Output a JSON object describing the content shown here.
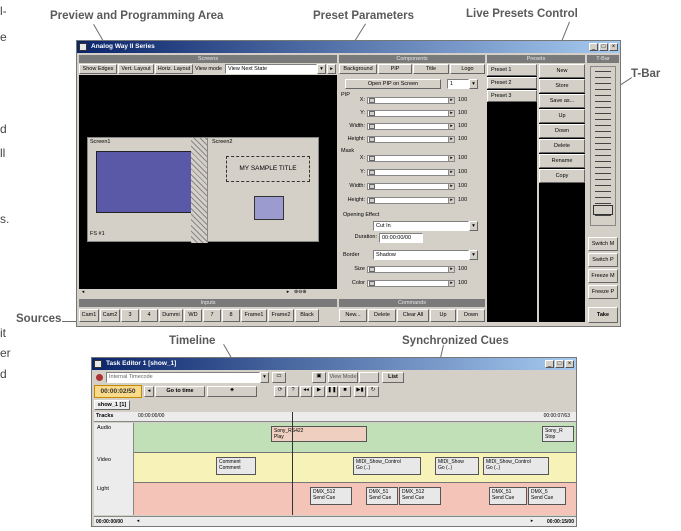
{
  "side_text": {
    "t1": "l-",
    "t2": "e",
    "t3": "d",
    "t4": "ll",
    "t5": "s.",
    "t6": "it",
    "t7": "er",
    "t8": "d"
  },
  "callouts": {
    "preview": "Preview and Programming Area",
    "preset_params": "Preset Parameters",
    "live_presets": "Live Presets Control",
    "tbar": "T-Bar",
    "sources": "Sources",
    "timeline": "Timeline",
    "sync_cues": "Synchronized Cues"
  },
  "main_window": {
    "title": "Analog Way II Series",
    "window_buttons": [
      "_",
      "□",
      "×"
    ],
    "screens_pane": {
      "header": "Screens",
      "toolbar": [
        "Show Edges",
        "Vert. Layout",
        "Horiz. Layout",
        "View mode"
      ],
      "view_mode_value": "View Next State",
      "screen1_label": "Screen1",
      "screen2_label": "Screen2",
      "sample_title": "MY SAMPLE TITLE",
      "fs_label": "FS #1"
    },
    "inputs_pane": {
      "header": "Inputs",
      "items": [
        "Cam1",
        "Cam2",
        "3",
        "4",
        "Dummi",
        "WD",
        "7",
        "8",
        "Frame1",
        "Frame2",
        "Black"
      ]
    },
    "components_pane": {
      "header": "Components",
      "tabs": [
        "Background",
        "PIP",
        "Title",
        "Logo"
      ],
      "open_pip_label": "Open PIP on Screen",
      "open_pip_value": "1",
      "pip_label": "PIP",
      "mask_label": "Mask",
      "rows": [
        {
          "label": "X:",
          "value": "100"
        },
        {
          "label": "Y:",
          "value": "100"
        },
        {
          "label": "Width:",
          "value": "100"
        },
        {
          "label": "Height:",
          "value": "100"
        }
      ],
      "mask_rows": [
        {
          "label": "X:",
          "value": "100"
        },
        {
          "label": "Y:",
          "value": "100"
        },
        {
          "label": "Width:",
          "value": "100"
        },
        {
          "label": "Height:",
          "value": "100"
        }
      ],
      "opening_effect_label": "Opening Effect",
      "opening_effect_value": "Cut In",
      "duration_label": "Duration:",
      "duration_value": "00:00:00/00",
      "border_label": "Border",
      "border_value": "Shadow",
      "size_label": "Size",
      "size_value": "100",
      "color_label": "Color",
      "color_value": "100"
    },
    "commands_pane": {
      "header": "Commands",
      "buttons": [
        "New...",
        "Delete",
        "Clear All",
        "Up",
        "Down"
      ]
    },
    "presets_pane": {
      "header": "Presets",
      "items": [
        "Preset 1",
        "Preset 2",
        "Preset 3"
      ],
      "buttons": [
        "New",
        "Store",
        "Save as...",
        "Up",
        "Down",
        "Delete",
        "Rename",
        "Copy"
      ]
    },
    "tbar_pane": {
      "header": "T-Bar",
      "buttons": [
        "Switch M",
        "Switch P",
        "Freeze M",
        "Freeze P"
      ],
      "take": "Take"
    }
  },
  "task_editor": {
    "title": "Task Editor 1 [show_1]",
    "window_buttons": [
      "_",
      "□",
      "×"
    ],
    "timecode_source": "Internal Timecode",
    "timecode": "00:00:02/50",
    "goto_label": "Go to time",
    "view_mode_label": "View Mode",
    "list_label": "List",
    "tab": "show_1 [1]",
    "tracks_label": "Tracks",
    "ruler_start": "00:00:00/00",
    "ruler_end": "00:00:07/63",
    "tracks": [
      "Audio",
      "Video",
      "Light"
    ],
    "audio_cues": [
      {
        "name": "Sony_RS422",
        "sub": "Play"
      },
      {
        "name": "Sony_R",
        "sub": "Stop"
      }
    ],
    "video_cues": [
      {
        "name": "Comment",
        "sub": "Comment"
      },
      {
        "name": "MIDI_Show_Control",
        "sub": "Go (..)"
      },
      {
        "name": "MIDI_Show",
        "sub": "Go (..)"
      },
      {
        "name": "MIDI_Show_Control",
        "sub": "Go (..)"
      }
    ],
    "light_cues": [
      {
        "name": "DMX_512",
        "sub": "Send Cue"
      },
      {
        "name": "DMX_51",
        "sub": "Send Cue"
      },
      {
        "name": "DMX_512",
        "sub": "Send Cue"
      },
      {
        "name": "DMX_51",
        "sub": "Send Cue"
      },
      {
        "name": "DMX_5",
        "sub": "Send Cue"
      }
    ],
    "footer_left": "00:00:00/00",
    "footer_right": "00:00:15/00"
  },
  "colors": {
    "audio_track": "#c2e0b8",
    "video_track": "#f7f2b8",
    "light_track": "#f5c4b8",
    "screen_blue": "#5959a8",
    "screen_small": "#9b9bd0",
    "title_bar": "#0a246a"
  }
}
